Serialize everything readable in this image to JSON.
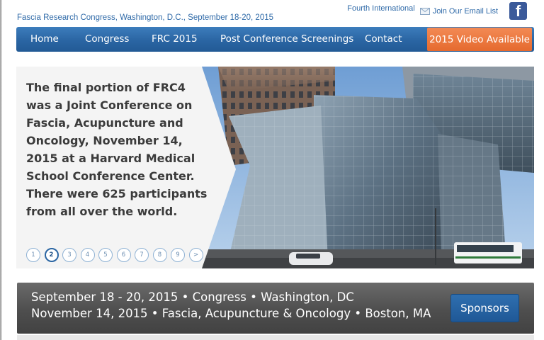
{
  "header": {
    "subtitle": "Fascia Research Congress, Washington, D.C., September 18-20, 2015",
    "links": {
      "fourth_international": "Fourth International",
      "email_list": "Join Our Email List"
    },
    "icons": {
      "mail": "envelope-icon",
      "facebook": "facebook-icon",
      "facebook_letter": "f"
    }
  },
  "nav": {
    "items": [
      {
        "label": "Home"
      },
      {
        "label": "Congress"
      },
      {
        "label": "FRC 2015"
      },
      {
        "label": "Post Conference Screenings"
      },
      {
        "label": "Contact"
      }
    ],
    "cta_label": "2015 Video Available"
  },
  "slider": {
    "caption": "The final portion of FRC4 was a Joint Conference on Fascia, Acupuncture and Oncology, November 14, 2015 at a Harvard Medical School Conference Center. There were 625 participants from all over the world.",
    "pager": [
      "1",
      "2",
      "3",
      "4",
      "5",
      "6",
      "7",
      "8",
      "9",
      ">"
    ],
    "active_page": "2"
  },
  "banner": {
    "line1": "September 18 - 20, 2015 • Congress • Washington, DC",
    "line2": "November 14, 2015 • Fascia, Acupuncture & Oncology • Boston, MA",
    "sponsors_label": "Sponsors"
  },
  "colors": {
    "nav_blue": "#2a65a3",
    "cta_orange": "#e8763f",
    "link_blue": "#2f6aa8",
    "banner_gray": "#555555",
    "facebook_blue": "#3b5a9a"
  }
}
